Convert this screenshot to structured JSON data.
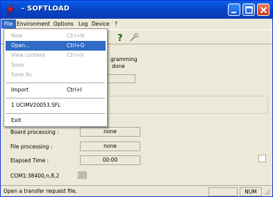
{
  "window": {
    "title": "- SOFTLOAD"
  },
  "menubar": [
    "File",
    "Environment",
    "Options",
    "Log",
    "Device",
    "?"
  ],
  "file_menu": {
    "items": [
      {
        "label": "New",
        "accel": "Ctrl+N",
        "enabled": false
      },
      {
        "label": "Open...",
        "accel": "Ctrl+O",
        "enabled": true,
        "highlighted": true
      },
      {
        "label": "View content",
        "accel": "Ctrl+V",
        "enabled": false
      },
      {
        "label": "Save",
        "accel": "",
        "enabled": false
      },
      {
        "label": "Save As",
        "accel": "",
        "enabled": false
      },
      {
        "label": "Import",
        "accel": "Ctrl+I",
        "enabled": true
      },
      {
        "label": "1 UCIMV20053.SFL",
        "accel": "",
        "enabled": true
      },
      {
        "label": "Exit",
        "accel": "",
        "enabled": true
      }
    ]
  },
  "programming": {
    "line1": "gramming",
    "line2": "done"
  },
  "status_fields": {
    "board_label": "Board processing :",
    "board_value": "none",
    "file_label": "File processing :",
    "file_value": "none",
    "elapsed_label": "Elapsed Time :",
    "elapsed_value": "00:00"
  },
  "port": {
    "text": "COM1:38400,n,8,2"
  },
  "statusbar": {
    "message": "Open a transfer request file.",
    "num": "NUM"
  },
  "colors": {
    "titlebar": "#0842c6",
    "highlight": "#316ac5",
    "face": "#ece9d8"
  }
}
